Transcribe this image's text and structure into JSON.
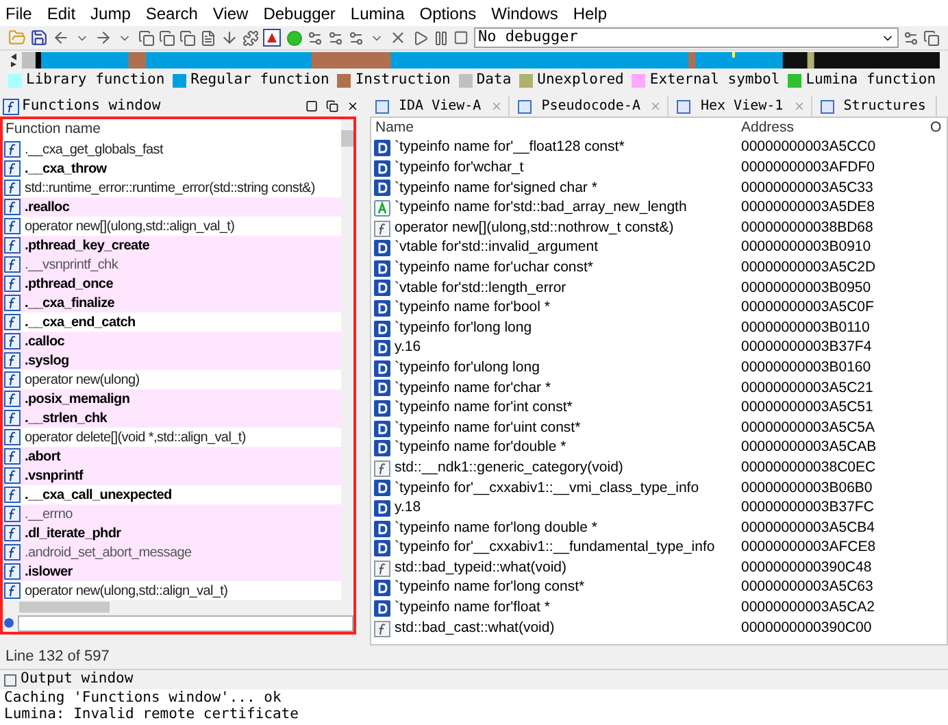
{
  "menu": [
    "File",
    "Edit",
    "Jump",
    "Search",
    "View",
    "Debugger",
    "Lumina",
    "Options",
    "Windows",
    "Help"
  ],
  "toolbar": {
    "debugger_select": "No debugger"
  },
  "legend": [
    {
      "label": "Library function",
      "color": "#a8ffff"
    },
    {
      "label": "Regular function",
      "color": "#00a0e0"
    },
    {
      "label": "Instruction",
      "color": "#b07050"
    },
    {
      "label": "Data",
      "color": "#c0c0c0"
    },
    {
      "label": "Unexplored",
      "color": "#b0b070"
    },
    {
      "label": "External symbol",
      "color": "#ffa8ff"
    },
    {
      "label": "Lumina function",
      "color": "#30c030"
    }
  ],
  "functions_window": {
    "title": "Functions window",
    "column": "Function name",
    "rows": [
      {
        "name": ".__cxa_get_globals_fast",
        "bold": false,
        "external": false
      },
      {
        "name": ".__cxa_throw",
        "bold": true,
        "external": false
      },
      {
        "name": "std::runtime_error::runtime_error(std::string const&)",
        "bold": false,
        "external": false
      },
      {
        "name": ".realloc",
        "bold": true,
        "external": true
      },
      {
        "name": "operator new[](ulong,std::align_val_t)",
        "bold": false,
        "external": false
      },
      {
        "name": ".pthread_key_create",
        "bold": true,
        "external": true
      },
      {
        "name": ".__vsnprintf_chk",
        "bold": false,
        "external": true
      },
      {
        "name": ".pthread_once",
        "bold": true,
        "external": true
      },
      {
        "name": ".__cxa_finalize",
        "bold": true,
        "external": true
      },
      {
        "name": ".__cxa_end_catch",
        "bold": true,
        "external": false
      },
      {
        "name": ".calloc",
        "bold": true,
        "external": true
      },
      {
        "name": ".syslog",
        "bold": true,
        "external": true
      },
      {
        "name": "operator new(ulong)",
        "bold": false,
        "external": false
      },
      {
        "name": ".posix_memalign",
        "bold": true,
        "external": true
      },
      {
        "name": ".__strlen_chk",
        "bold": true,
        "external": true
      },
      {
        "name": "operator delete[](void *,std::align_val_t)",
        "bold": false,
        "external": false
      },
      {
        "name": ".abort",
        "bold": true,
        "external": true
      },
      {
        "name": ".vsnprintf",
        "bold": true,
        "external": true
      },
      {
        "name": ".__cxa_call_unexpected",
        "bold": true,
        "external": false
      },
      {
        "name": ".__errno",
        "bold": false,
        "external": true
      },
      {
        "name": ".dl_iterate_phdr",
        "bold": true,
        "external": true
      },
      {
        "name": ".android_set_abort_message",
        "bold": false,
        "external": true
      },
      {
        "name": ".islower",
        "bold": true,
        "external": true
      },
      {
        "name": "operator new(ulong,std::align_val_t)",
        "bold": false,
        "external": false
      }
    ],
    "status": "Line 132 of 597"
  },
  "tabs": [
    "IDA View-A",
    "Pseudocode-A",
    "Hex View-1",
    "Structures"
  ],
  "names_table": {
    "columns": [
      "Name",
      "Address",
      "O"
    ],
    "rows": [
      {
        "kind": "data",
        "name": "`typeinfo name for'__float128 const*",
        "address": "00000000003A5CC0"
      },
      {
        "kind": "data",
        "name": "`typeinfo for'wchar_t",
        "address": "00000000003AFDF0"
      },
      {
        "kind": "data",
        "name": "`typeinfo name for'signed char *",
        "address": "00000000003A5C33"
      },
      {
        "kind": "string",
        "name": "`typeinfo name for'std::bad_array_new_length",
        "address": "00000000003A5DE8"
      },
      {
        "kind": "function",
        "name": "operator new[](ulong,std::nothrow_t const&)",
        "address": "000000000038BD68"
      },
      {
        "kind": "data",
        "name": "`vtable for'std::invalid_argument",
        "address": "00000000003B0910"
      },
      {
        "kind": "data",
        "name": "`typeinfo name for'uchar const*",
        "address": "00000000003A5C2D"
      },
      {
        "kind": "data",
        "name": "`vtable for'std::length_error",
        "address": "00000000003B0950"
      },
      {
        "kind": "data",
        "name": "`typeinfo name for'bool *",
        "address": "00000000003A5C0F"
      },
      {
        "kind": "data",
        "name": "`typeinfo for'long long",
        "address": "00000000003B0110"
      },
      {
        "kind": "data",
        "name": "y.16",
        "address": "00000000003B37F4"
      },
      {
        "kind": "data",
        "name": "`typeinfo for'ulong long",
        "address": "00000000003B0160"
      },
      {
        "kind": "data",
        "name": "`typeinfo name for'char *",
        "address": "00000000003A5C21"
      },
      {
        "kind": "data",
        "name": "`typeinfo name for'int const*",
        "address": "00000000003A5C51"
      },
      {
        "kind": "data",
        "name": "`typeinfo name for'uint const*",
        "address": "00000000003A5C5A"
      },
      {
        "kind": "data",
        "name": "`typeinfo name for'double *",
        "address": "00000000003A5CAB"
      },
      {
        "kind": "function",
        "name": "std::__ndk1::generic_category(void)",
        "address": "000000000038C0EC"
      },
      {
        "kind": "data",
        "name": "`typeinfo for'__cxxabiv1::__vmi_class_type_info",
        "address": "00000000003B06B0"
      },
      {
        "kind": "data",
        "name": "y.18",
        "address": "00000000003B37FC"
      },
      {
        "kind": "data",
        "name": "`typeinfo name for'long double *",
        "address": "00000000003A5CB4"
      },
      {
        "kind": "data",
        "name": "`typeinfo for'__cxxabiv1::__fundamental_type_info",
        "address": "00000000003AFCE8"
      },
      {
        "kind": "function",
        "name": "std::bad_typeid::what(void)",
        "address": "0000000000390C48"
      },
      {
        "kind": "data",
        "name": "`typeinfo name for'long const*",
        "address": "00000000003A5C63"
      },
      {
        "kind": "data",
        "name": "`typeinfo name for'float *",
        "address": "00000000003A5CA2"
      },
      {
        "kind": "function",
        "name": "std::bad_cast::what(void)",
        "address": "0000000000390C00"
      }
    ]
  },
  "output_window": {
    "title": "Output window",
    "lines": [
      "Caching 'Functions window'... ok",
      "Lumina: Invalid remote certificate"
    ]
  }
}
